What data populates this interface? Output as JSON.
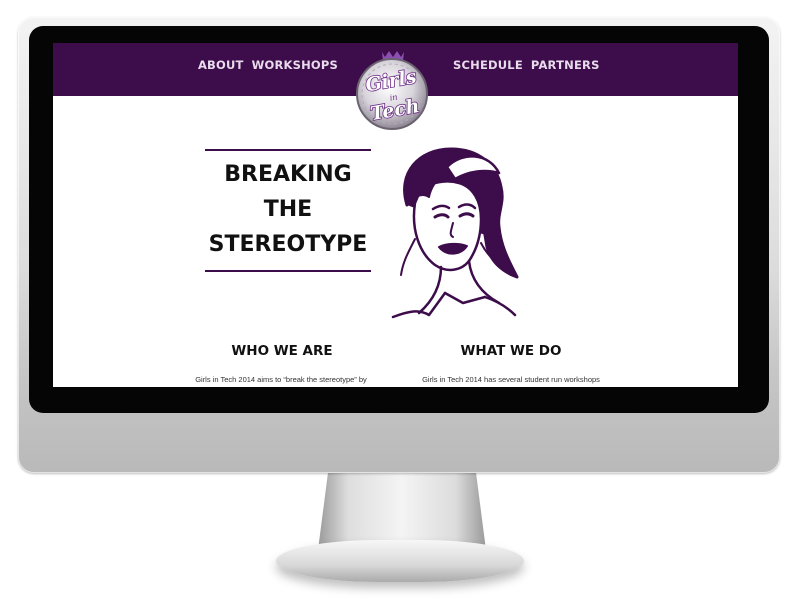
{
  "nav": {
    "left_items": [
      "ABOUT",
      "WORKSHOPS"
    ],
    "right_items": [
      "SCHEDULE",
      "PARTNERS"
    ]
  },
  "logo": {
    "line1": "Girls",
    "line2": "in",
    "line3": "Tech"
  },
  "hero": {
    "title_lines": [
      "BREAKING",
      "THE",
      "STEREOTYPE"
    ]
  },
  "sections": [
    {
      "title": "WHO WE ARE",
      "text": "Girls in Tech 2014 aims to “break the stereotype” by"
    },
    {
      "title": "WHAT WE DO",
      "text": "Girls in Tech 2014 has several student run workshops"
    }
  ],
  "colors": {
    "brand_purple": "#3d0c4a",
    "logo_purple": "#6b2a85",
    "nav_text": "#e8dcec"
  }
}
